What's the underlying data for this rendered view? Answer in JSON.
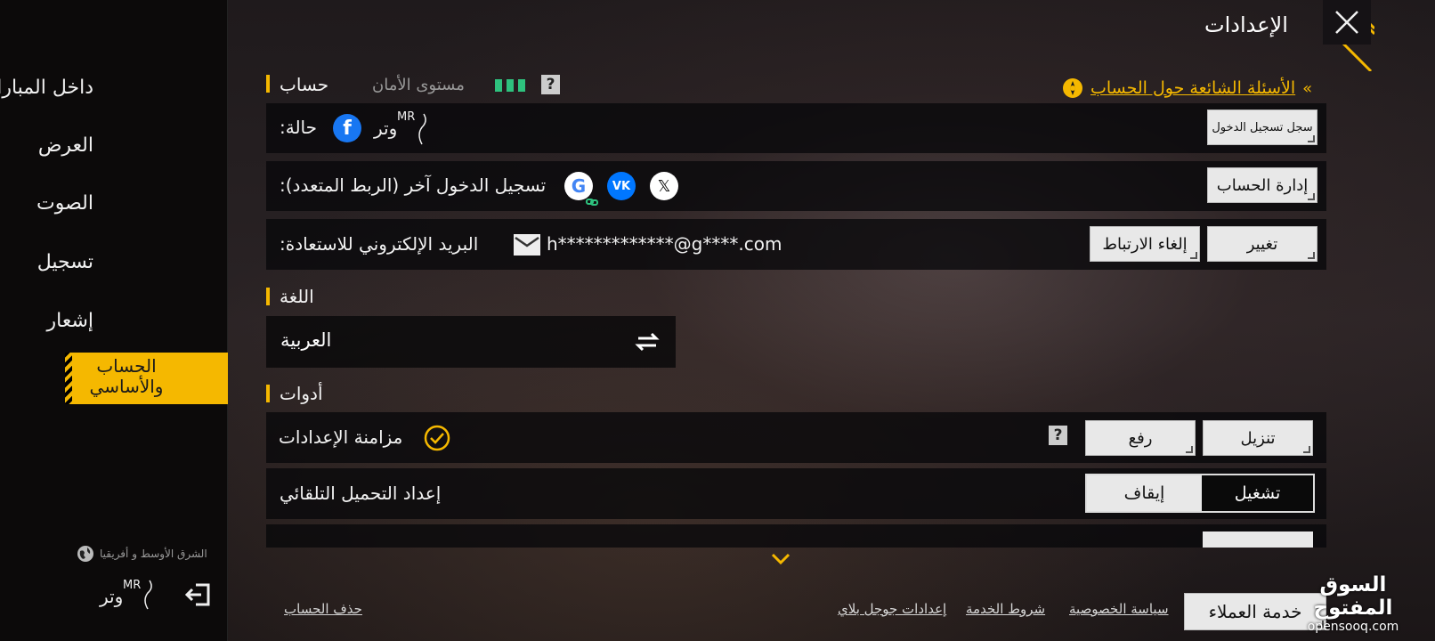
{
  "sidebar": {
    "items": [
      {
        "label": "داخل المباراة"
      },
      {
        "label": "العرض"
      },
      {
        "label": "الصوت"
      },
      {
        "label": "تسجيل"
      },
      {
        "label": "إشعار"
      }
    ],
    "active_label": "الحساب والأساسي",
    "region_label": "الشرق الأوسط و أفريقيا",
    "player_name": "وتر",
    "player_tag": "MR"
  },
  "header": {
    "title": "الإعدادات"
  },
  "account": {
    "section_title": "حساب",
    "security_label": "مستوى الأمان",
    "security_bars": 3,
    "faq_link": "الأسئلة الشائعة حول الحساب",
    "status_label": "حالة:",
    "status_name": "وتر",
    "status_tag": "MR",
    "login_history_button": "سجل تسجيل الدخول",
    "other_login_label": "تسجيل الدخول آخر (الربط المتعدد):",
    "manage_account_button": "إدارة الحساب",
    "recovery_email_label": "البريد الإلكتروني للاستعادة:",
    "recovery_email_value": "h*************@g****.com",
    "change_button": "تغيير",
    "unlink_button": "إلغاء الارتباط"
  },
  "language": {
    "section_title": "اللغة",
    "current": "العربية"
  },
  "tools": {
    "section_title": "أدوات",
    "sync_label": "مزامنة الإعدادات",
    "download_button": "تنزيل",
    "upload_button": "رفع",
    "auto_load_label": "إعداد التحميل التلقائي",
    "toggle_on": "تشغيل",
    "toggle_off": "إيقاف",
    "toggle_state": "on"
  },
  "footer": {
    "delete_account": "حذف الحساب",
    "google_play_settings": "إعدادات جوجل بلاي",
    "terms": "شروط الخدمة",
    "privacy": "سياسة الخصوصية",
    "customer_service": "خدمة العملاء"
  },
  "watermark": {
    "arabic": "السوق المفتوح",
    "latin": "opensooq.com"
  },
  "colors": {
    "accent": "#f5b800",
    "security_green": "#2ec27e",
    "facebook": "#1877f2",
    "vk": "#0077ff"
  }
}
